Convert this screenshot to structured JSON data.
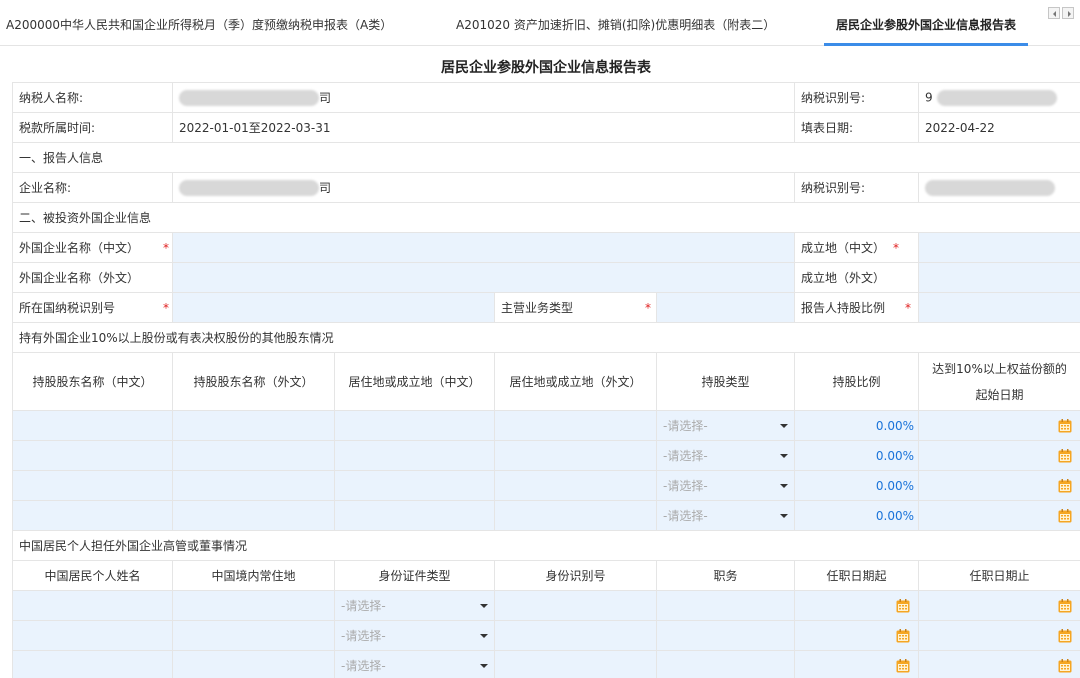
{
  "tabs": [
    {
      "label": "A200000中华人民共和国企业所得税月（季）度预缴纳税申报表（A类）"
    },
    {
      "label": "A201020 资产加速折旧、摊销(扣除)优惠明细表（附表二）"
    },
    {
      "label": "居民企业参股外国企业信息报告表"
    }
  ],
  "form": {
    "title": "居民企业参股外国企业信息报告表",
    "taxpayer_name_label": "纳税人名称:",
    "taxpayer_name_prefix": "",
    "taxpayer_name_suffix": "司",
    "tax_id_label": "纳税识别号:",
    "tax_id_prefix": "9",
    "period_label": "税款所属时间:",
    "period_value": "2022-01-01至2022-03-31",
    "fill_date_label": "填表日期:",
    "fill_date_value": "2022-04-22",
    "section1": "一、报告人信息",
    "company_name_label": "企业名称:",
    "company_name_suffix": "司",
    "tax_id_label2": "纳税识别号:",
    "section2": "二、被投资外国企业信息",
    "foreign_name_cn_label": "外国企业名称（中文）",
    "est_place_cn_label": "成立地（中文）",
    "foreign_name_foreign_label": "外国企业名称（外文）",
    "est_place_foreign_label": "成立地（外文）",
    "foreign_tax_id_label": "所在国纳税识别号",
    "main_business_label": "主营业务类型",
    "holding_ratio_label": "报告人持股比例",
    "required_mark": "*",
    "section3": "持有外国企业10%以上股份或有表决权股份的其他股东情况",
    "shareholder_headers": [
      "持股股东名称（中文）",
      "持股股东名称（外文）",
      "居住地或成立地（中文）",
      "居住地或成立地（外文）",
      "持股类型",
      "持股比例"
    ],
    "shareholder_date_header_line1": "达到10%以上权益份额的",
    "shareholder_date_header_line2": "起始日期",
    "shareholder_rows": [
      {
        "type": "-请选择-",
        "ratio": "0.00%"
      },
      {
        "type": "-请选择-",
        "ratio": "0.00%"
      },
      {
        "type": "-请选择-",
        "ratio": "0.00%"
      },
      {
        "type": "-请选择-",
        "ratio": "0.00%"
      }
    ],
    "section4": "中国居民个人担任外国企业高管或董事情况",
    "officer_headers": [
      "中国居民个人姓名",
      "中国境内常住地",
      "身份证件类型",
      "身份识别号",
      "职务",
      "任职日期起",
      "任职日期止"
    ],
    "officer_rows": [
      {
        "id_type": "-请选择-"
      },
      {
        "id_type": "-请选择-"
      },
      {
        "id_type": "-请选择-"
      }
    ]
  },
  "colors": {
    "accent": "#3b8ce8",
    "fill": "#eaf3fd",
    "required": "#e02020",
    "calendar": "#f5a623"
  }
}
